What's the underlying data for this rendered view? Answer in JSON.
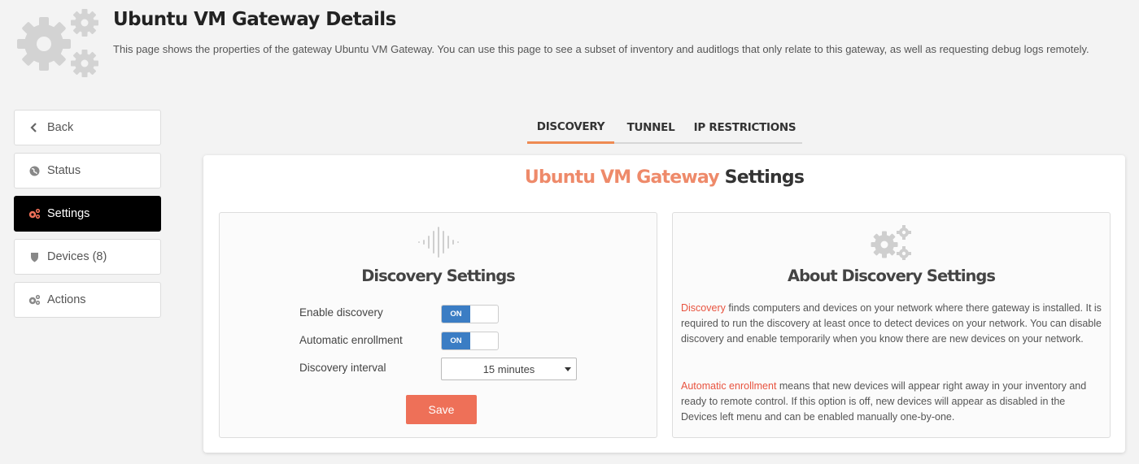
{
  "header": {
    "title": "Ubuntu VM Gateway Details",
    "description": "This page shows the properties of the gateway Ubuntu VM Gateway. You can use this page to see a subset of inventory and auditlogs that only relate to this gateway, as well as requesting debug logs remotely."
  },
  "sidebar": {
    "items": [
      {
        "label": "Back",
        "icon": "chevron-left-icon"
      },
      {
        "label": "Status",
        "icon": "globe-icon"
      },
      {
        "label": "Settings",
        "icon": "gears-icon",
        "active": true
      },
      {
        "label": "Devices (8)",
        "icon": "shield-icon"
      },
      {
        "label": "Actions",
        "icon": "gears-icon"
      }
    ]
  },
  "tabs": [
    {
      "label": "DISCOVERY",
      "active": true
    },
    {
      "label": "TUNNEL"
    },
    {
      "label": "IP RESTRICTIONS"
    }
  ],
  "panel": {
    "title_accent": "Ubuntu VM Gateway",
    "title_rest": " Settings"
  },
  "discovery_card": {
    "heading": "Discovery Settings",
    "icon": "sound-wave-icon",
    "enable_discovery_label": "Enable discovery",
    "enable_discovery_toggle": "ON",
    "automatic_enrollment_label": "Automatic enrollment",
    "automatic_enrollment_toggle": "ON",
    "interval_label": "Discovery interval",
    "interval_value": "15 minutes",
    "save_label": "Save"
  },
  "about_card": {
    "heading": "About Discovery Settings",
    "icon": "gears-icon",
    "p1_highlight": "Discovery",
    "p1_text": " finds computers and devices on your network where there gateway is installed. It is required to run the discovery at least once to detect devices on your network. You can disable discovery and enable temporarily when you know there are new devices on your network.",
    "p2_highlight": "Automatic enrollment",
    "p2_text": " means that new devices will appear right away in your inventory and ready to remote control. If this option is off, new devices will appear as disabled in the Devices left menu and can be enabled manually one-by-one."
  },
  "colors": {
    "accent": "#ee8a52",
    "save_button": "#ee7058",
    "toggle_on": "#3b7dc4",
    "highlight_text": "#e8533f",
    "active_sidebar": "#000000"
  }
}
